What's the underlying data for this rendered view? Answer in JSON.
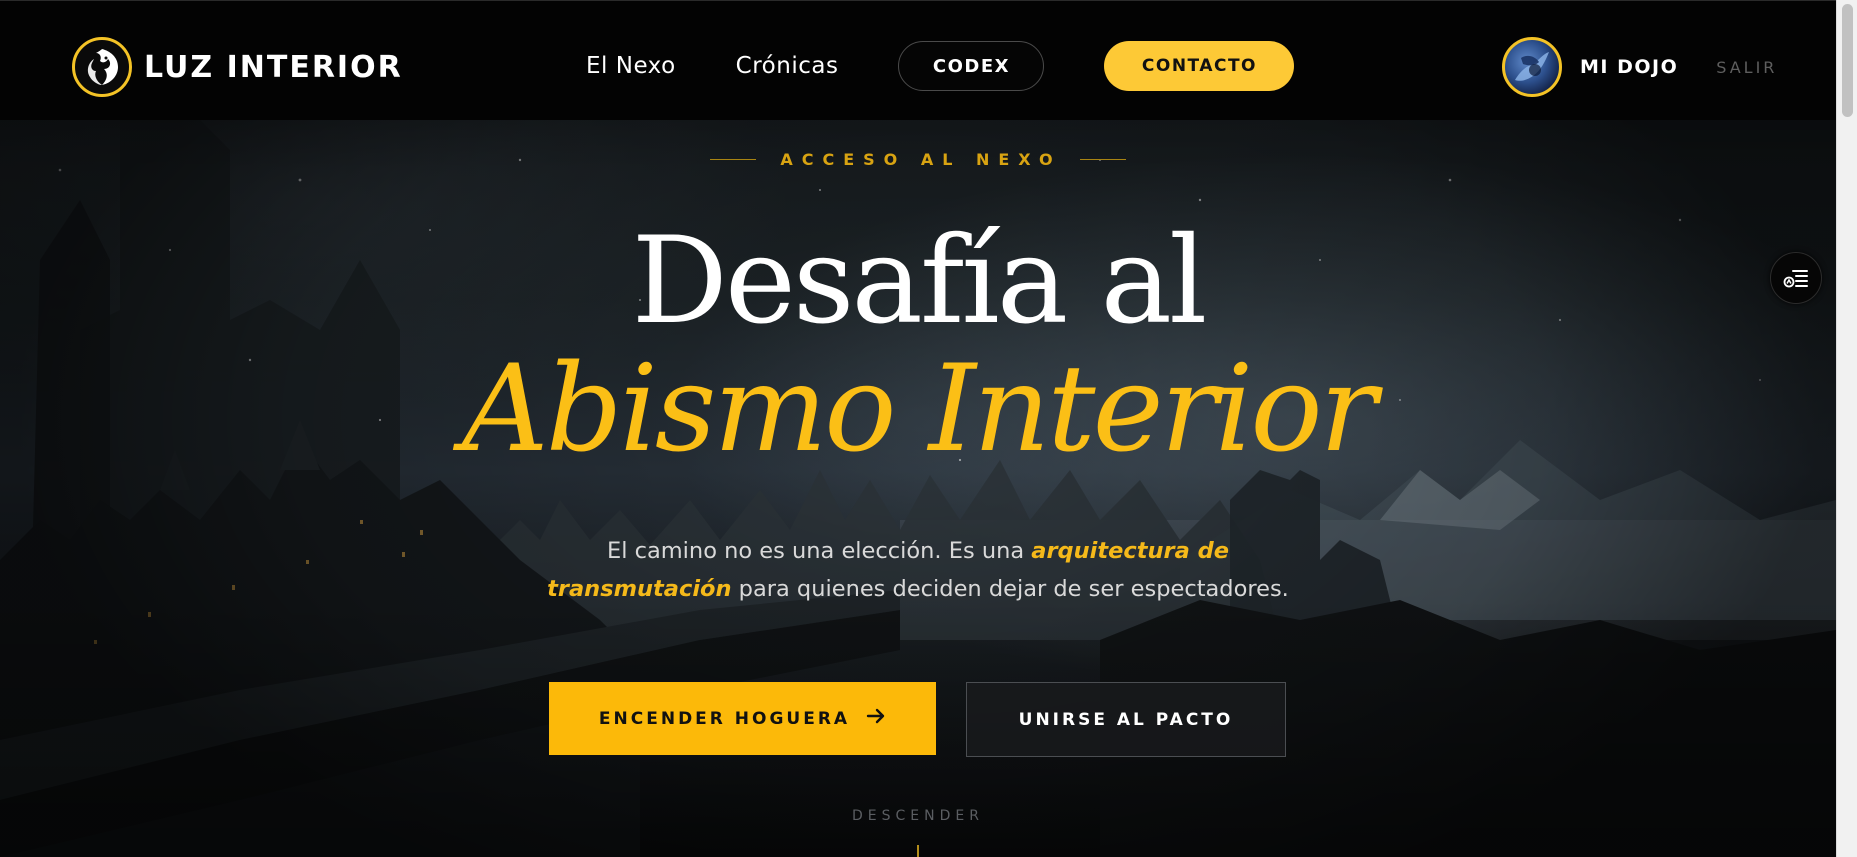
{
  "brand": {
    "name": "LUZ INTERIOR",
    "logo_icon": "dragon-icon"
  },
  "nav": {
    "items": [
      {
        "label": "El Nexo"
      },
      {
        "label": "Crónicas"
      }
    ],
    "codex_label": "CODEX",
    "contact_label": "CONTACTO"
  },
  "user": {
    "name": "MI DOJO",
    "logout_label": "SALIR",
    "avatar_icon": "user-avatar"
  },
  "hero": {
    "eyebrow": "ACCESO AL NEXO",
    "title_line1": "Desafía al",
    "title_line2": "Abismo Interior",
    "subtitle": {
      "part1": "El camino no es una elección. Es una ",
      "highlight1": "arquitectura de transmutación",
      "part2": " para quienes deciden dejar de ser espectadores."
    },
    "primary_cta": "ENCENDER HOGUERA",
    "primary_cta_icon": "arrow-right-icon",
    "secondary_cta": "UNIRSE AL PACTO",
    "scroll_hint": "DESCENDER"
  },
  "floating": {
    "toc_icon": "reading-list-icon"
  },
  "colors": {
    "accent": "#fcb909",
    "accent_text": "#f5b91a",
    "header_bg": "#030303",
    "eyebrow": "#d8a312"
  }
}
